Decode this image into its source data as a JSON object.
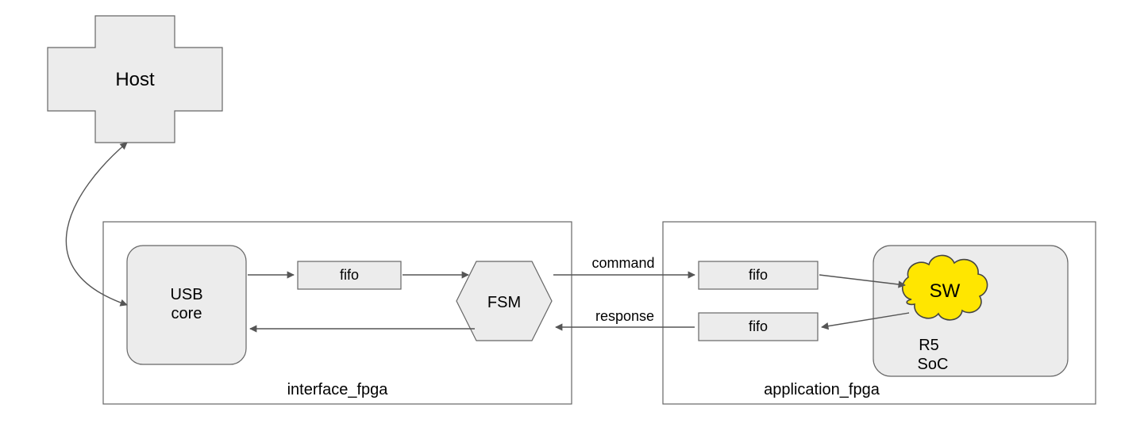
{
  "nodes": {
    "host": {
      "label": "Host"
    },
    "usb_core": {
      "line1": "USB",
      "line2": "core"
    },
    "fifo_if": {
      "label": "fifo"
    },
    "fsm": {
      "label": "FSM"
    },
    "fifo_cmd": {
      "label": "fifo"
    },
    "fifo_resp": {
      "label": "fifo"
    },
    "soc": {
      "line1": "R5",
      "line2": "SoC"
    },
    "sw_cloud": {
      "label": "SW"
    }
  },
  "frames": {
    "interface_fpga": {
      "label": "interface_fpga"
    },
    "application_fpga": {
      "label": "application_fpga"
    }
  },
  "edges": {
    "command": {
      "label": "command"
    },
    "response": {
      "label": "response"
    }
  }
}
